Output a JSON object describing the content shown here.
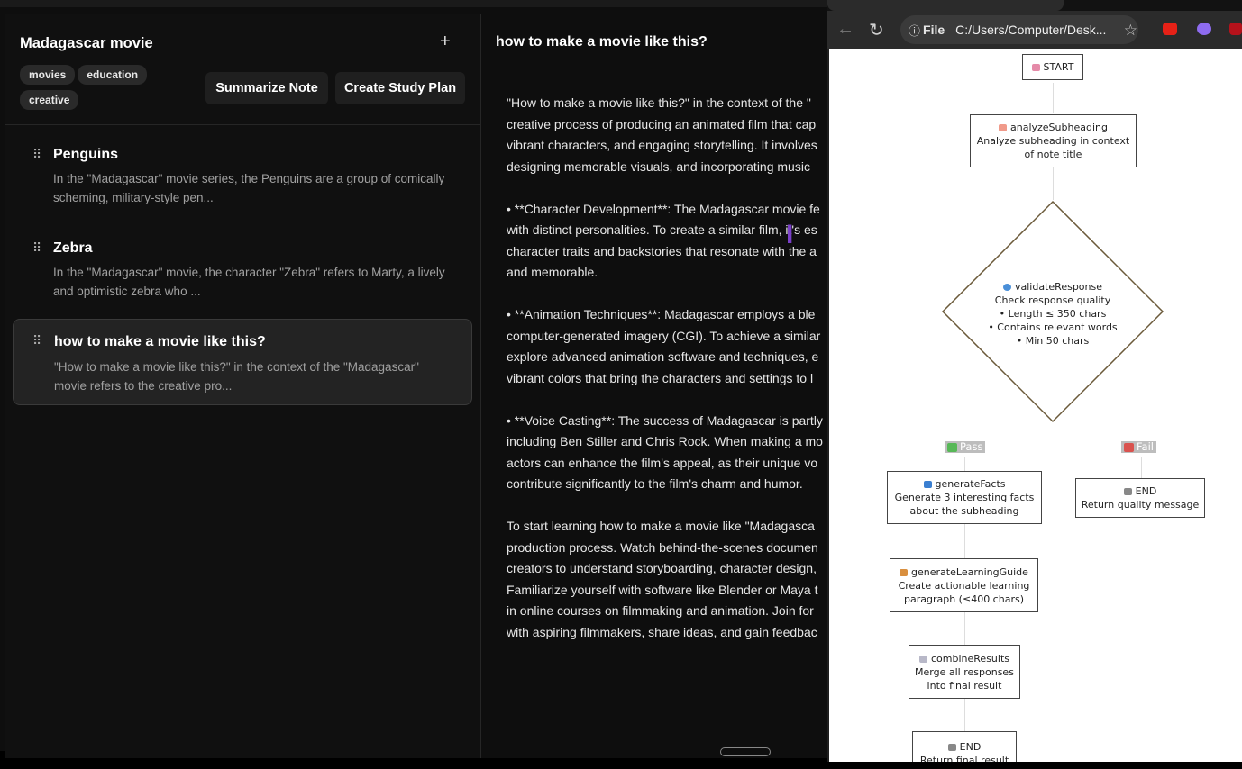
{
  "note": {
    "title": "Madagascar movie",
    "add_label": "+",
    "tags": [
      "movies",
      "education",
      "creative"
    ],
    "summarize_label": "Summarize Note",
    "study_plan_label": "Create Study Plan"
  },
  "subheadings": [
    {
      "title": "Penguins",
      "preview": "In the \"Madagascar\" movie series, the Penguins are a group of comically scheming, military-style pen...",
      "active": false
    },
    {
      "title": "Zebra",
      "preview": "In the \"Madagascar\" movie, the character \"Zebra\" refers to Marty, a lively and optimistic zebra who ...",
      "active": false
    },
    {
      "title": "how to make a movie like this?",
      "preview": "\"How to make a movie like this?\" in the context of the \"Madagascar\" movie refers to the creative pro...",
      "active": true
    }
  ],
  "detail": {
    "title": "how to make a movie like this?",
    "paragraphs": [
      [
        "\"How to make a movie like this?\" in the context of the \"",
        "creative process of producing an animated film that cap",
        "vibrant characters, and engaging storytelling. It involves",
        "designing memorable visuals, and incorporating music"
      ],
      [
        "• **Character Development**: The Madagascar movie fe",
        "with distinct personalities. To create a similar film, it's es",
        "character traits and backstories that resonate with the a",
        "and memorable."
      ],
      [
        "• **Animation Techniques**: Madagascar employs a ble",
        "computer-generated imagery (CGI). To achieve a similar",
        "explore advanced animation software and techniques, e",
        "vibrant colors that bring the characters and settings to l"
      ],
      [
        "• **Voice Casting**: The success of Madagascar is partly",
        "including Ben Stiller and Chris Rock. When making a mo",
        "actors can enhance the film's appeal, as their unique vo",
        "contribute significantly to the film's charm and humor."
      ],
      [
        "To start learning how to make a movie like \"Madagasca",
        "production process. Watch behind-the-scenes documen",
        "creators to understand storyboarding, character design,",
        "Familiarize yourself with software like Blender or Maya t",
        "in online courses on filmmaking and animation. Join for",
        "with aspiring filmmakers, share ideas, and gain feedbac"
      ]
    ]
  },
  "browser": {
    "file_label": "File",
    "url": "C:/Users/Computer/Desk...",
    "info_icon": "info-icon",
    "colors": {
      "youtube": "#e62117",
      "shield": "#8e6cf0",
      "ublock": "#b5121b"
    }
  },
  "flow": {
    "start": "START",
    "analyze_name": "analyzeSubheading",
    "analyze_desc": [
      "Analyze subheading in context",
      "of note title"
    ],
    "validate_name": "validateResponse",
    "validate_desc": [
      "Check response quality",
      "• Length ≤ 350 chars",
      "• Contains relevant words",
      "• Min 50 chars"
    ],
    "pass_label": "Pass",
    "fail_label": "Fail",
    "facts_name": "generateFacts",
    "facts_desc": [
      "Generate 3 interesting facts",
      "about the subheading"
    ],
    "end_fail_name": "END",
    "end_fail_desc": "Return quality message",
    "guide_name": "generateLearningGuide",
    "guide_desc": [
      "Create actionable learning",
      "paragraph (≤400 chars)"
    ],
    "combine_name": "combineResults",
    "combine_desc": [
      "Merge all responses",
      "into final result"
    ],
    "end_name": "END",
    "end_desc": "Return final result",
    "colors": {
      "pass": "#57b857",
      "fail": "#d9534f",
      "diamond": "#6b5a3a"
    }
  }
}
